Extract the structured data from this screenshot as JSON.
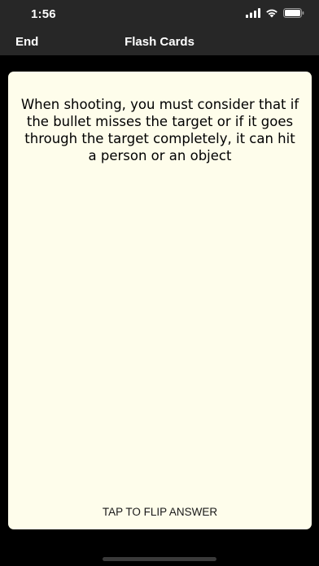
{
  "status_bar": {
    "time": "1:56",
    "icons": [
      "signal-icon",
      "wifi-icon",
      "battery-icon"
    ]
  },
  "nav": {
    "end_label": "End",
    "title": "Flash Cards"
  },
  "card": {
    "question": "When shooting, you must consider that if the bullet misses the target or if it goes through the target completely, it can hit a person or an object",
    "hint": "TAP TO FLIP ANSWER"
  },
  "colors": {
    "background": "#000000",
    "bar": "#272727",
    "card": "#fefdeb",
    "text_light": "#ffffff"
  }
}
